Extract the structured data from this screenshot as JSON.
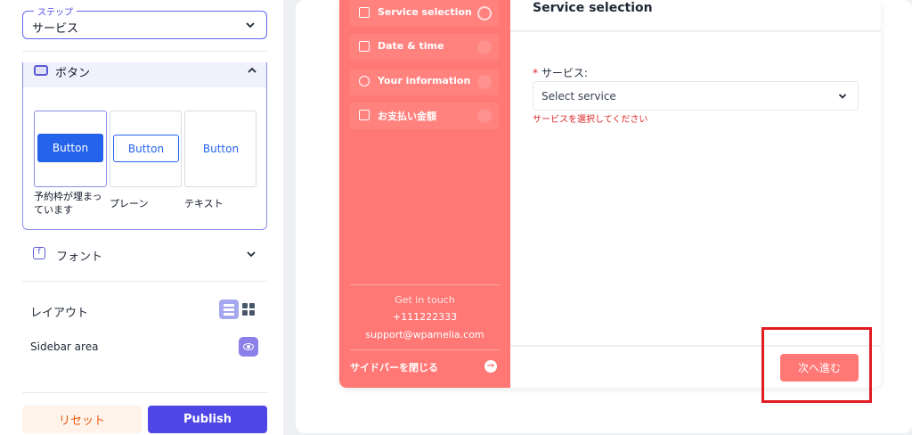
{
  "editor": {
    "step_select": {
      "legend": "ステップ",
      "value": "サービス"
    },
    "button_section": {
      "title": "ボタン",
      "options": [
        {
          "preview_label": "Button",
          "caption": "予約枠が埋まっています",
          "style": "solid",
          "selected": true
        },
        {
          "preview_label": "Button",
          "caption": "プレーン",
          "style": "outline",
          "selected": false
        },
        {
          "preview_label": "Button",
          "caption": "テキスト",
          "style": "text",
          "selected": false
        }
      ]
    },
    "font_section": {
      "title": "フォント"
    },
    "layout": {
      "label": "レイアウト"
    },
    "sidebar_area": {
      "label": "Sidebar area"
    },
    "actions": {
      "reset_label": "リセット",
      "publish_label": "Publish"
    }
  },
  "preview": {
    "steps": [
      {
        "label": "Service selection",
        "icon": "bag-icon",
        "active": true
      },
      {
        "label": "Date & time",
        "icon": "calendar-icon",
        "active": false
      },
      {
        "label": "Your information",
        "icon": "user-icon",
        "active": false
      },
      {
        "label": "お支払い金額",
        "icon": "card-icon",
        "active": false
      }
    ],
    "contact": {
      "heading": "Get in touch",
      "phone": "+111222333",
      "email": "support@wpamelia.com"
    },
    "close_sidebar_label": "サイドバーを閉じる",
    "main": {
      "title": "Service selection",
      "field_label": "サービス:",
      "required_mark": "*",
      "select_placeholder": "Select service",
      "error_text": "サービスを選択してください",
      "next_label": "次へ進む"
    }
  },
  "colors": {
    "accent": "#4f46e5",
    "brand_coral": "#ff7875",
    "button_blue": "#2563eb",
    "error": "#dc2626",
    "highlight": "#e11d24"
  }
}
